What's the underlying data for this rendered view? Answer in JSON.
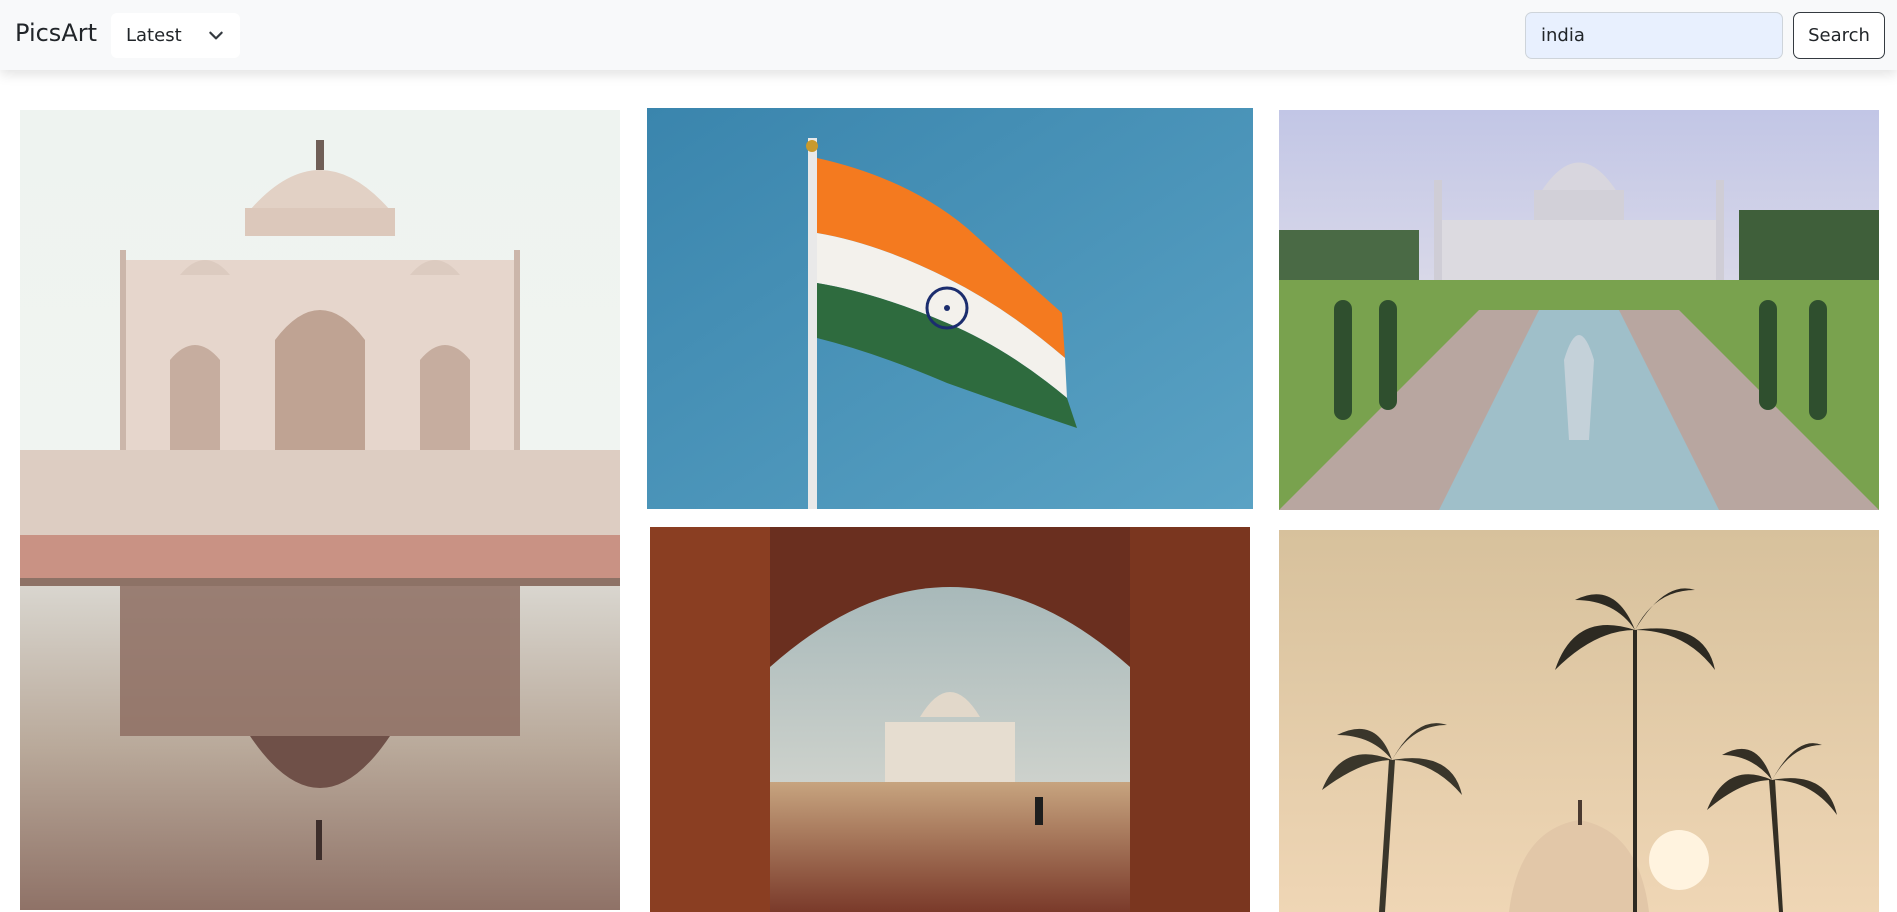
{
  "navbar": {
    "brand": "PicsArt",
    "sort": {
      "selected": "Latest"
    },
    "search": {
      "value": "india",
      "button_label": "Search"
    }
  },
  "gallery": {
    "photos": [
      {
        "subject": "taj-mahal-reflection-pool"
      },
      {
        "subject": "indian-flag"
      },
      {
        "subject": "taj-mahal-gardens"
      },
      {
        "subject": "taj-mahal-through-archway"
      },
      {
        "subject": "palm-trees-sunset-dome"
      }
    ]
  },
  "colors": {
    "navbar_bg": "#f8f9fa",
    "search_bg": "#e8f0fe",
    "saffron": "#f47a1f",
    "india_green": "#2e6b3e",
    "chakra_blue": "#1b2d6e"
  }
}
